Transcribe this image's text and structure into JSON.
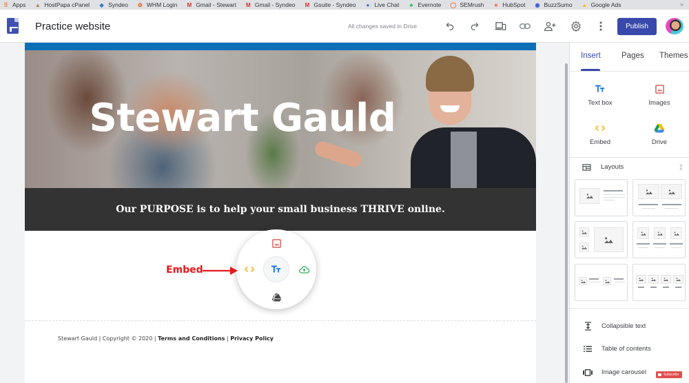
{
  "bookmarks": [
    {
      "label": "Apps",
      "icon": "apps-grid-icon",
      "color": "#e8711a"
    },
    {
      "label": "HostPapa cPanel",
      "icon": "hostpapa-icon",
      "color": "#b07a3a"
    },
    {
      "label": "Syndeo",
      "icon": "syndeo-icon",
      "color": "#2a7fd4"
    },
    {
      "label": "WHM Login",
      "icon": "whm-icon",
      "color": "#f26522"
    },
    {
      "label": "Gmail - Stewart",
      "icon": "gmail-icon",
      "color": "#d93025"
    },
    {
      "label": "Gmail - Syndeo",
      "icon": "gmail-icon",
      "color": "#d93025"
    },
    {
      "label": "Gsuite - Syndeo",
      "icon": "gmail-icon",
      "color": "#d93025"
    },
    {
      "label": "Live Chat",
      "icon": "live-chat-icon",
      "color": "#2f6fd8"
    },
    {
      "label": "Evernote",
      "icon": "evernote-icon",
      "color": "#2dbe60"
    },
    {
      "label": "SEMrush",
      "icon": "semrush-icon",
      "color": "#ff642d"
    },
    {
      "label": "HubSpot",
      "icon": "hubspot-icon",
      "color": "#ff7a59"
    },
    {
      "label": "BuzzSumo",
      "icon": "buzzsumo-icon",
      "color": "#3a5bd9"
    },
    {
      "label": "Google Ads",
      "icon": "google-ads-icon",
      "color": "#fbbc04"
    }
  ],
  "bookmarks_more": "»",
  "header": {
    "title": "Practice website",
    "save_status": "All changes saved in Drive",
    "publish_label": "Publish",
    "toolbar_icons": [
      "undo-icon",
      "redo-icon",
      "preview-devices-icon",
      "copy-link-icon",
      "share-add-person-icon",
      "settings-gear-icon",
      "more-vert-icon"
    ]
  },
  "page": {
    "hero_title": "Stewart Gauld",
    "purpose_text": "Our PURPOSE is to help your small business THRIVE online.",
    "footer": {
      "prefix": "Stewart Gauld | Copyright © 2020 | ",
      "terms": "Terms and Conditions",
      "separator": " | ",
      "privacy": "Privacy Policy"
    },
    "radial_menu": {
      "items": [
        "Images",
        "Embed",
        "Text box",
        "Upload",
        "Drive"
      ]
    }
  },
  "annotation": {
    "label": "Embed",
    "color": "#e6171b"
  },
  "panel": {
    "tabs": [
      {
        "label": "Insert",
        "active": true
      },
      {
        "label": "Pages",
        "active": false
      },
      {
        "label": "Themes",
        "active": false
      }
    ],
    "insert_items": [
      {
        "label": "Text box",
        "icon": "text-box-icon"
      },
      {
        "label": "Images",
        "icon": "image-icon"
      },
      {
        "label": "Embed",
        "icon": "embed-code-icon"
      },
      {
        "label": "Drive",
        "icon": "google-drive-icon"
      }
    ],
    "layouts_label": "Layouts",
    "tools": [
      {
        "label": "Collapsible text",
        "icon": "collapsible-text-icon"
      },
      {
        "label": "Table of contents",
        "icon": "table-of-contents-icon"
      },
      {
        "label": "Image carousel",
        "icon": "image-carousel-icon"
      }
    ],
    "subscribe_label": "Subscribe"
  },
  "colors": {
    "accent": "#3949ab",
    "nav_blue": "#0b6fb8",
    "band_dark": "#333333"
  }
}
